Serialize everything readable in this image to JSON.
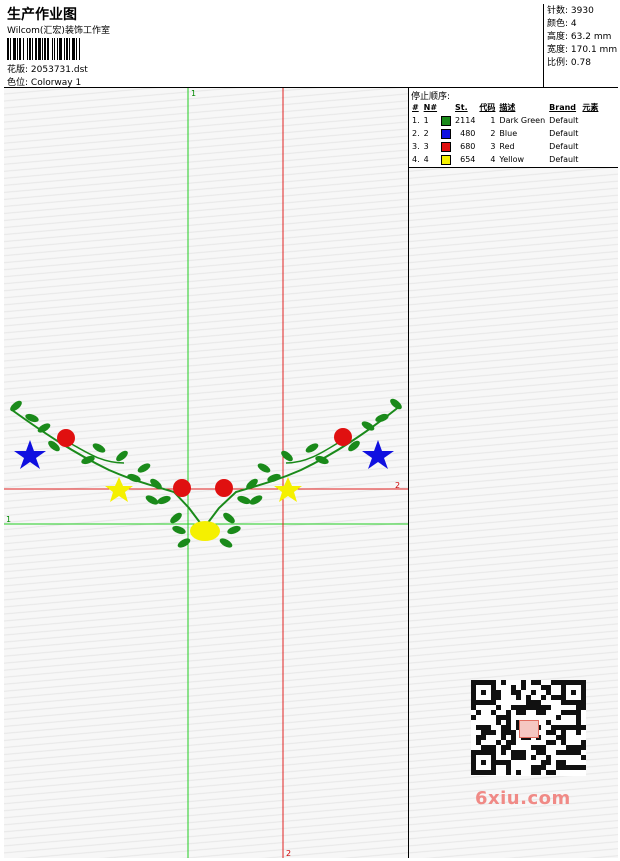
{
  "header": {
    "title": "生产作业图",
    "company": "Wilcom(汇宏)装饰工作室",
    "design_file_label": "花版:",
    "design_file": "2053731.dst",
    "colorway_label": "色位:",
    "colorway": "Colorway 1"
  },
  "specs": {
    "stitches_label": "针数:",
    "stitches": "3930",
    "colors_label": "颜色:",
    "colors": "4",
    "height_label": "高度:",
    "height": "63.2 mm",
    "width_label": "宽度:",
    "width": "170.1 mm",
    "scale_label": "比例:",
    "scale": "0.78"
  },
  "stop_sequence": {
    "title": "停止顺序:",
    "columns": [
      "#",
      "N#",
      "St.",
      "代码",
      "描述",
      "Brand",
      "元素"
    ],
    "rows": [
      {
        "index": "1.",
        "needle": "1",
        "color": "#1a8a1a",
        "stitches": "2114",
        "code": "1",
        "description": "Dark Green",
        "brand": "Default"
      },
      {
        "index": "2.",
        "needle": "2",
        "color": "#1010e0",
        "stitches": "480",
        "code": "2",
        "description": "Blue",
        "brand": "Default"
      },
      {
        "index": "3.",
        "needle": "3",
        "color": "#e01010",
        "stitches": "680",
        "code": "3",
        "description": "Red",
        "brand": "Default"
      },
      {
        "index": "4.",
        "needle": "4",
        "color": "#f5f000",
        "stitches": "654",
        "code": "4",
        "description": "Yellow",
        "brand": "Default"
      }
    ]
  },
  "guides": {
    "green_label": "1",
    "red_label": "2"
  },
  "watermark": "6xiu.com"
}
